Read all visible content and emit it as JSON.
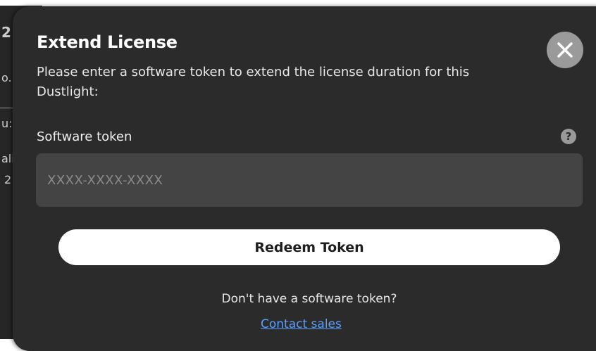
{
  "background": {
    "fragments": [
      "2",
      "o.",
      "u:",
      "ali",
      "2"
    ]
  },
  "dialog": {
    "title": "Extend License",
    "description": "Please enter a software token to extend the license duration for this Dustlight:",
    "close_icon": "close-icon",
    "field": {
      "label": "Software token",
      "help_icon": "question-mark-icon",
      "help_glyph": "?",
      "placeholder": "XXXX-XXXX-XXXX",
      "value": ""
    },
    "redeem_label": "Redeem Token",
    "no_token_text": "Don't have a software token?",
    "contact_label": "Contact sales"
  },
  "colors": {
    "modal_bg": "#2b2b2b",
    "input_bg": "#444444",
    "link": "#5aa0ff",
    "close_bg": "#9a9a9a"
  }
}
